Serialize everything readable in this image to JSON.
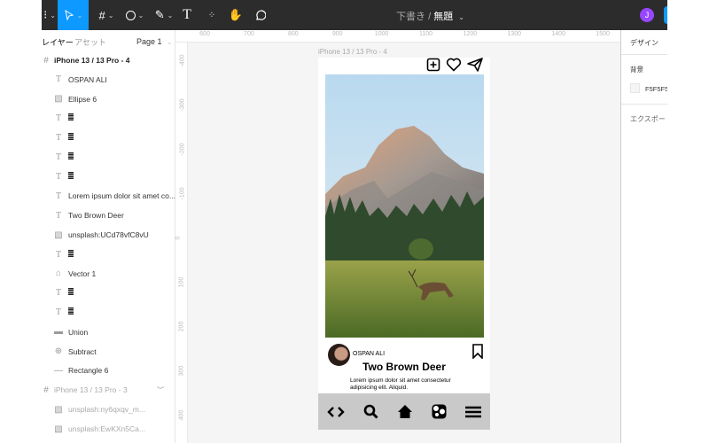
{
  "toolbar": {
    "tools": [
      "main-menu",
      "move",
      "frame",
      "shape",
      "pen",
      "text",
      "resources",
      "hand",
      "comment"
    ],
    "breadcrumb_folder": "下書き",
    "breadcrumb_sep": "/",
    "file_name": "無題",
    "user_initial": "J",
    "accent": "#0d99ff",
    "avatar_color": "#9747ff"
  },
  "layers_panel": {
    "tab_layers": "レイヤー",
    "tab_assets": "アセット",
    "page": "Page 1",
    "items": [
      {
        "type": "frame",
        "label": "iPhone 13 / 13 Pro - 4"
      },
      {
        "type": "text",
        "label": "OSPAN ALI"
      },
      {
        "type": "image",
        "label": "Ellipse 6"
      },
      {
        "type": "text",
        "label": ""
      },
      {
        "type": "text",
        "label": ""
      },
      {
        "type": "text",
        "label": ""
      },
      {
        "type": "text",
        "label": ""
      },
      {
        "type": "text",
        "label": "Lorem ipsum dolor sit amet co..."
      },
      {
        "type": "text",
        "label": "Two Brown Deer"
      },
      {
        "type": "image",
        "label": "unsplash:UCd78vfC8vU"
      },
      {
        "type": "text",
        "label": ""
      },
      {
        "type": "vector",
        "label": "Vector 1"
      },
      {
        "type": "text",
        "label": ""
      },
      {
        "type": "text",
        "label": ""
      },
      {
        "type": "union",
        "label": "Union"
      },
      {
        "type": "subtract",
        "label": "Subtract"
      },
      {
        "type": "rect",
        "label": "Rectangle 6"
      },
      {
        "type": "frame",
        "label": "iPhone 13 / 13 Pro - 3",
        "dim": true
      },
      {
        "type": "image",
        "label": "unsplash:ny6qxqv_m...",
        "dim": true
      },
      {
        "type": "image",
        "label": "unsplash:EwKXn5Ca...",
        "dim": true
      }
    ]
  },
  "rulers": {
    "h": [
      "600",
      "700",
      "800",
      "900",
      "1000",
      "1100",
      "1200",
      "1300",
      "1400",
      "1500"
    ],
    "v": [
      "-400",
      "-300",
      "-200",
      "-100",
      "0",
      "100",
      "200",
      "300",
      "400"
    ]
  },
  "design_panel": {
    "tab": "デザイン",
    "bg_label": "背景",
    "bg_value": "F5F5F5",
    "export": "エクスポート"
  },
  "frame": {
    "label": "iPhone 13 / 13 Pro - 4",
    "user": "OSPAN ALI",
    "title": "Two Brown Deer",
    "body": "Lorem ipsum dolor sit amet consectetur adipisicing elit. Aliquid.",
    "nav_icons": [
      "code-icon",
      "search-icon",
      "home-icon",
      "apps-icon",
      "menu-icon"
    ]
  }
}
